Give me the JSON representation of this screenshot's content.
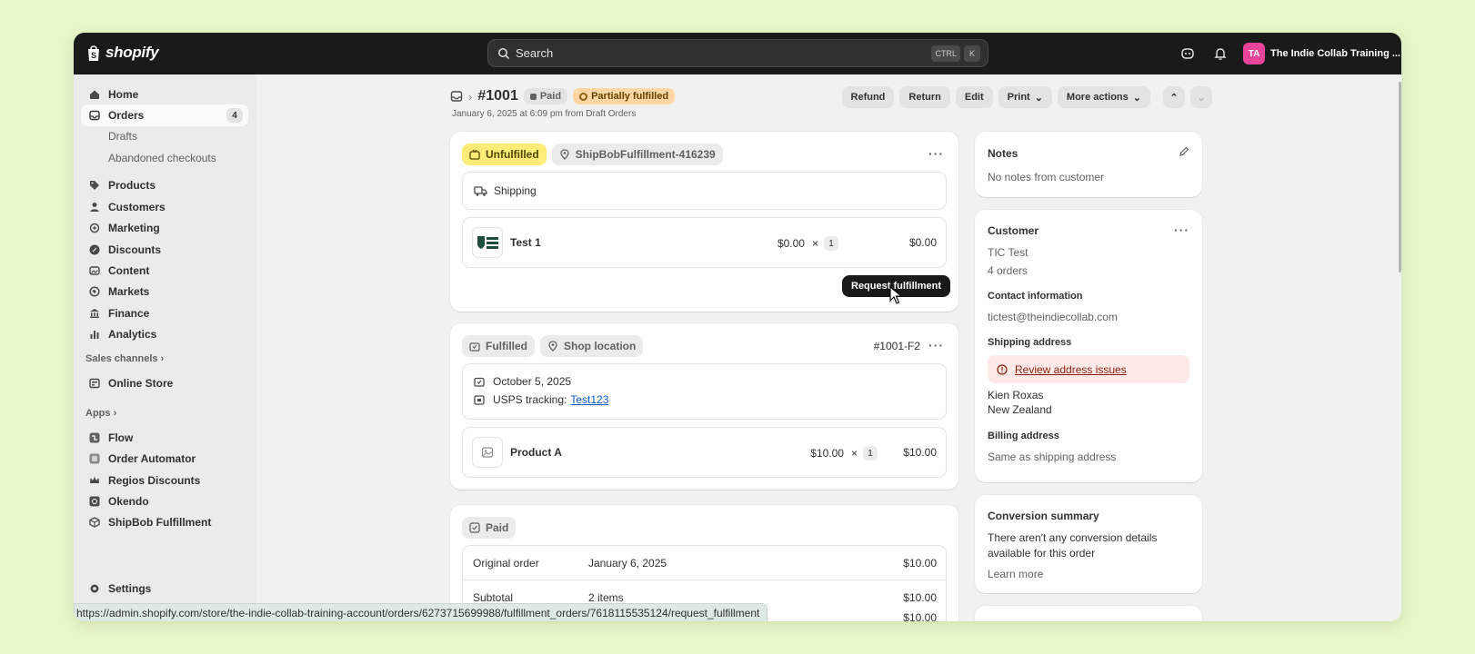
{
  "app": {
    "name": "shopify"
  },
  "search": {
    "placeholder": "Search",
    "kbd1": "CTRL",
    "kbd2": "K"
  },
  "store": {
    "initials": "TA",
    "name": "The Indie Collab Training ..."
  },
  "sidebar": {
    "home": "Home",
    "orders": "Orders",
    "orders_count": "4",
    "drafts": "Drafts",
    "abandoned": "Abandoned checkouts",
    "products": "Products",
    "customers": "Customers",
    "marketing": "Marketing",
    "discounts": "Discounts",
    "content": "Content",
    "markets": "Markets",
    "finance": "Finance",
    "analytics": "Analytics",
    "sales_channels": "Sales channels",
    "online_store": "Online Store",
    "apps": "Apps",
    "flow": "Flow",
    "order_automator": "Order Automator",
    "regios": "Regios Discounts",
    "okendo": "Okendo",
    "shipbob": "ShipBob Fulfillment",
    "settings": "Settings"
  },
  "order": {
    "number": "#1001",
    "paid_badge": "Paid",
    "fulfillment_badge": "Partially fulfilled",
    "subtitle": "January 6, 2025 at 6:09 pm from Draft Orders"
  },
  "actions": {
    "refund": "Refund",
    "return": "Return",
    "edit": "Edit",
    "print": "Print",
    "more": "More actions"
  },
  "unfulfilled": {
    "status": "Unfulfilled",
    "location": "ShipBobFulfillment-416239",
    "method": "Shipping",
    "item_name": "Test 1",
    "item_price": "$0.00",
    "times": "×",
    "item_qty": "1",
    "item_total": "$0.00",
    "tooltip": "Request fulfillment"
  },
  "fulfilled": {
    "status": "Fulfilled",
    "location": "Shop location",
    "id": "#1001-F2",
    "date": "October 5, 2025",
    "tracking_label": "USPS tracking:",
    "tracking_number": "Test123",
    "item_name": "Product A",
    "item_price": "$10.00",
    "times": "×",
    "item_qty": "1",
    "item_total": "$10.00"
  },
  "payment": {
    "status": "Paid",
    "original_label": "Original order",
    "original_date": "January 6, 2025",
    "original_amount": "$10.00",
    "subtotal_label": "Subtotal",
    "subtotal_items": "2 items",
    "subtotal_amount": "$10.00",
    "next_amount": "$10.00"
  },
  "notes": {
    "title": "Notes",
    "text": "No notes from customer"
  },
  "customer": {
    "title": "Customer",
    "name": "TIC Test",
    "orders": "4 orders",
    "contact_title": "Contact information",
    "email": "tictest@theindiecollab.com",
    "shipping_title": "Shipping address",
    "alert": "Review address issues",
    "address_line1": "Kien Roxas",
    "address_line2": "New Zealand",
    "billing_title": "Billing address",
    "billing_text": "Same as shipping address"
  },
  "conversion": {
    "title": "Conversion summary",
    "text_line1": "There aren't any conversion details",
    "text_line2": "available for this order",
    "learn_more": "Learn more"
  },
  "status_url": "https://admin.shopify.com/store/the-indie-collab-training-account/orders/6273715699988/fulfillment_orders/7618115535124/request_fulfillment",
  "colors": {
    "accent_link": "#005bd3",
    "unfulfilled": "#ffeb78",
    "partial": "#ffd6a4",
    "avatar": "#e8459a"
  }
}
